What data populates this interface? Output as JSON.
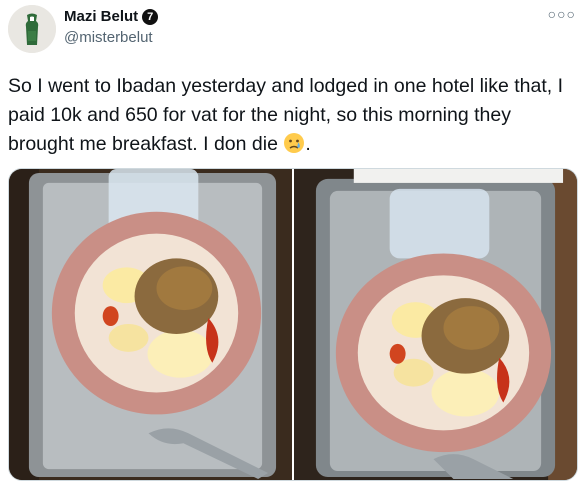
{
  "tweet": {
    "display_name": "Mazi Belut",
    "verified_badge": "7",
    "handle": "@misterbelut",
    "more_icon": "more-icon",
    "text": "So I went to Ibadan yesterday and lodged in one hotel like that, I paid 10k and 650 for vat for the night, so this morning they brought me breakfast.  I don die ",
    "text_end": ".",
    "emoji": "crying-face-icon"
  },
  "media": {
    "photos": [
      "breakfast-photo-1",
      "breakfast-photo-2"
    ]
  }
}
